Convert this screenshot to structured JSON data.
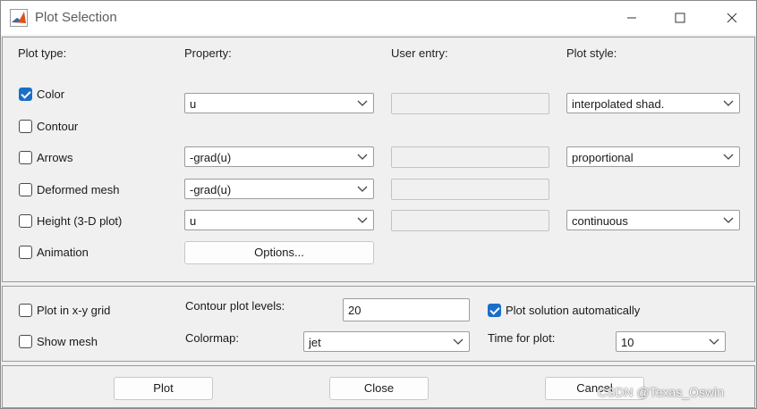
{
  "window": {
    "title": "Plot Selection",
    "app_icon": "matlab-icon",
    "controls": {
      "minimize": "minimize-icon",
      "maximize": "maximize-icon",
      "close": "close-icon"
    }
  },
  "headers": {
    "plot_type": "Plot type:",
    "property": "Property:",
    "user_entry": "User entry:",
    "plot_style": "Plot style:"
  },
  "plot_types": [
    {
      "label": "Color",
      "checked": true
    },
    {
      "label": "Contour",
      "checked": false
    },
    {
      "label": "Arrows",
      "checked": false
    },
    {
      "label": "Deformed mesh",
      "checked": false
    },
    {
      "label": "Height (3-D plot)",
      "checked": false
    },
    {
      "label": "Animation",
      "checked": false
    }
  ],
  "properties": {
    "color": "u",
    "arrows": "-grad(u)",
    "deformed_mesh": "-grad(u)",
    "height": "u"
  },
  "plot_styles": {
    "color": "interpolated shad.",
    "arrows": "proportional",
    "height": "continuous"
  },
  "options_button": "Options...",
  "lower": {
    "plot_in_grid": {
      "label": "Plot in x-y grid",
      "checked": false
    },
    "show_mesh": {
      "label": "Show mesh",
      "checked": false
    },
    "contour_levels_label": "Contour plot levels:",
    "contour_levels_value": "20",
    "colormap_label": "Colormap:",
    "colormap_value": "jet",
    "auto_plot": {
      "label": "Plot solution automatically",
      "checked": true
    },
    "time_label": "Time for plot:",
    "time_value": "10"
  },
  "buttons": {
    "plot": "Plot",
    "close": "Close",
    "cancel": "Cancel"
  },
  "watermark": "CSDN @Texas_Oswin",
  "colors": {
    "accent": "#1a6fc7",
    "panel_bg": "#f0f0f0",
    "titlebar_bg": "#ffffff"
  }
}
